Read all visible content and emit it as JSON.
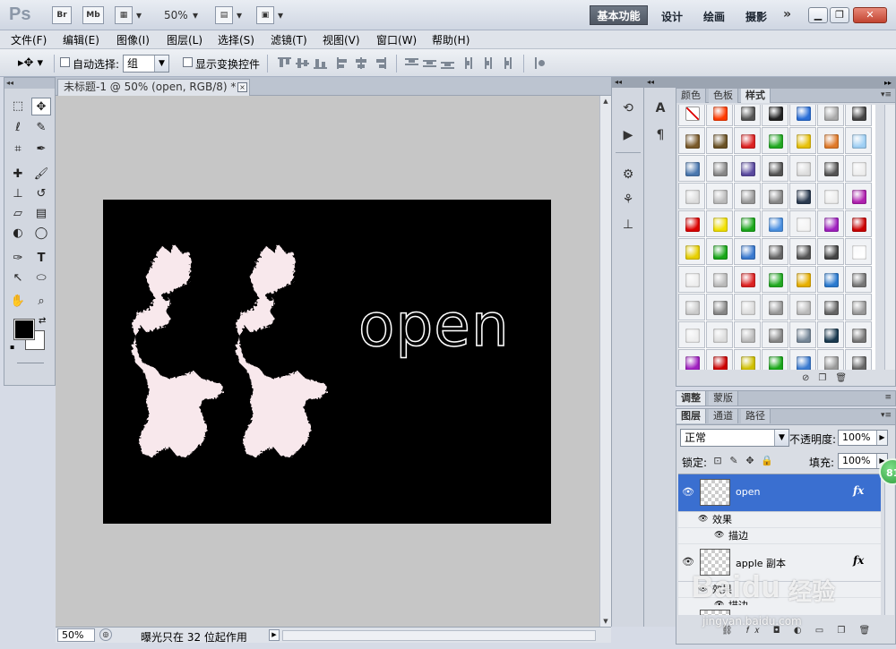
{
  "titlebar": {
    "app_logo": "Ps",
    "bridge_label": "Br",
    "minibridge_label": "Mb",
    "zoom": "50%",
    "workspaces": [
      "基本功能",
      "设计",
      "绘画",
      "摄影"
    ],
    "more_label": "»"
  },
  "menus": [
    "文件(F)",
    "编辑(E)",
    "图像(I)",
    "图层(L)",
    "选择(S)",
    "滤镜(T)",
    "视图(V)",
    "窗口(W)",
    "帮助(H)"
  ],
  "options": {
    "auto_select_label": "自动选择:",
    "auto_select_value": "组",
    "show_transform_label": "显示变换控件"
  },
  "tools": {
    "icons": [
      "rect-marquee",
      "move",
      "lasso",
      "quick-select",
      "crop",
      "eyedropper",
      "spot-heal",
      "brush",
      "clone-stamp",
      "history-brush",
      "eraser",
      "gradient",
      "blur",
      "dodge",
      "pen",
      "type",
      "path-select",
      "ellipse",
      "hand",
      "zoom"
    ],
    "foreground": "#000000",
    "background": "#ffffff"
  },
  "document": {
    "tab_title": "未标题-1 @ 50% (open, RGB/8) *",
    "close_label": "×",
    "canvas_text": "open",
    "canvas_bg": "#000000",
    "figure_fill": "#f8e8ec"
  },
  "status": {
    "zoom": "50%",
    "message": "曝光只在 32 位起作用"
  },
  "styles_panel": {
    "tabs": [
      "颜色",
      "色板",
      "样式"
    ],
    "active_tab": "样式"
  },
  "adjust_panel": {
    "tabs": [
      "调整",
      "蒙版"
    ]
  },
  "layers_panel": {
    "tabs": [
      "图层",
      "通道",
      "路径"
    ],
    "blend_mode": "正常",
    "opacity_label": "不透明度:",
    "opacity_value": "100%",
    "lock_label": "锁定:",
    "fill_label": "填充:",
    "fill_value": "100%",
    "effects_label": "效果",
    "stroke_label": "描边",
    "fx_label": "fx",
    "layers": [
      {
        "name": "open",
        "selected": true
      },
      {
        "name": "apple 副本",
        "selected": false
      },
      {
        "name": "apple",
        "selected": false
      }
    ]
  },
  "badge": "81",
  "watermark": {
    "logo": "Baidu",
    "cn": "经验",
    "url": "jingyan.baidu.com"
  }
}
